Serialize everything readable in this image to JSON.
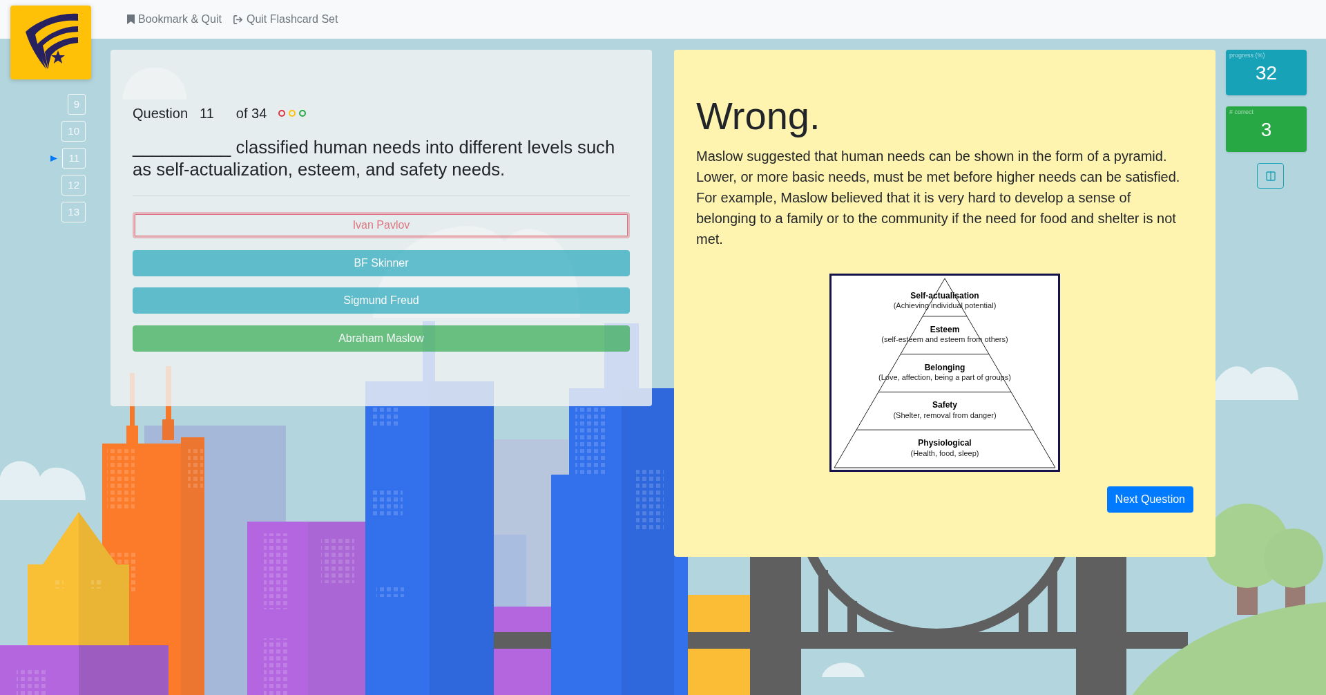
{
  "nav": {
    "links": [
      {
        "label": "Bookmark & Quit",
        "kind": "bookmark"
      },
      {
        "label": "Quit Flashcard Set",
        "kind": "quit"
      }
    ]
  },
  "question_nav": [
    {
      "label": "9",
      "selected": false
    },
    {
      "label": "10",
      "selected": false
    },
    {
      "label": "11",
      "selected": true
    },
    {
      "label": "12",
      "selected": false
    },
    {
      "label": "13",
      "selected": false
    }
  ],
  "question": {
    "label": "Question",
    "number": "11",
    "total": "of 34",
    "status_dots": [
      {
        "color": "#dc3545"
      },
      {
        "color": "#ffc107"
      },
      {
        "color": "#28a745"
      }
    ],
    "text": "__________ classified human needs into different levels such as self-actualization, esteem, and safety needs.",
    "answers": [
      {
        "label": "Ivan Pavlov",
        "selected": true,
        "correct": false,
        "disabled": true
      },
      {
        "label": "BF Skinner",
        "selected": false,
        "correct": false,
        "disabled": true
      },
      {
        "label": "Sigmund Freud",
        "selected": false,
        "correct": false,
        "disabled": true
      },
      {
        "label": "Abraham Maslow",
        "selected": false,
        "correct": true,
        "disabled": true
      }
    ]
  },
  "feedback": {
    "title": "Wrong.",
    "text": "Maslow suggested that human needs can be shown in the form of a pyramid. Lower, or more basic needs, must be met before higher needs can be satisfied. For example, Maslow believed that it is very hard to develop a sense of belonging to a family or to the community if the need for food and shelter is not met.",
    "diagram": {
      "levels": [
        {
          "title": "Self-actualisation",
          "detail": "(Achieving individual potential)"
        },
        {
          "title": "Esteem",
          "detail": "(self-esteem and esteem from others)"
        },
        {
          "title": "Belonging",
          "detail": "(Love, affection, being a part of groups)"
        },
        {
          "title": "Safety",
          "detail": "(Shelter, removal from danger)"
        },
        {
          "title": "Physiological",
          "detail": "(Health, food, sleep)"
        }
      ]
    },
    "next_button": "Next Question"
  },
  "stats": [
    {
      "kind": "progress",
      "label": "progress (%)",
      "value": "32"
    },
    {
      "kind": "correct",
      "label": "# correct",
      "value": "3"
    }
  ]
}
